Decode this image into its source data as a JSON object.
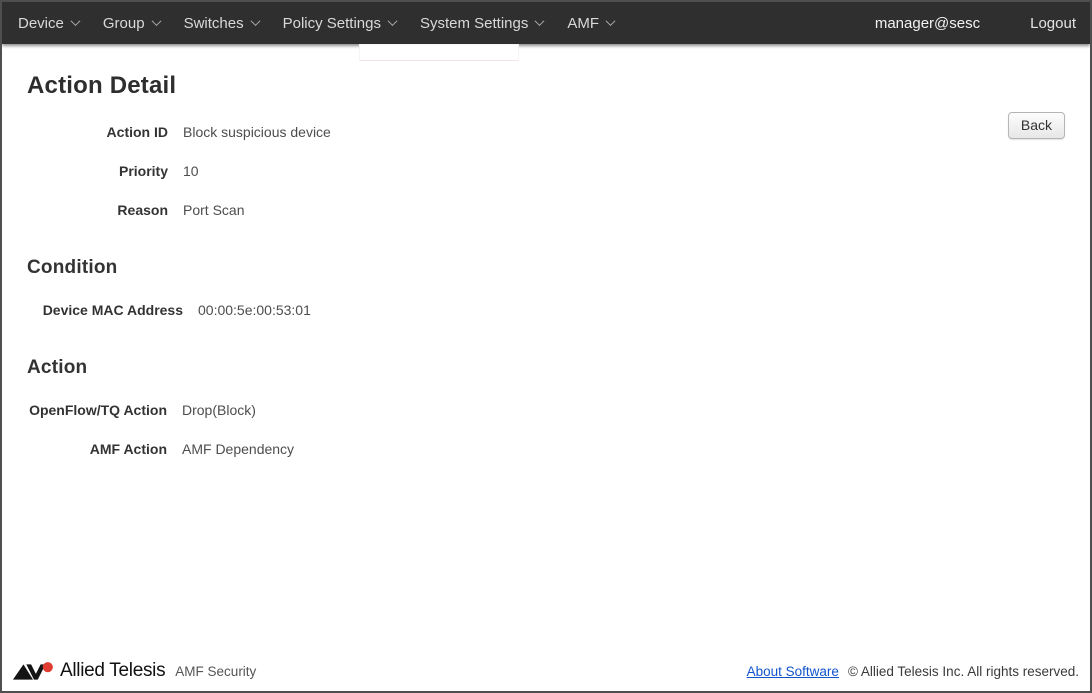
{
  "navbar": {
    "items": [
      {
        "label": "Device"
      },
      {
        "label": "Group"
      },
      {
        "label": "Switches"
      },
      {
        "label": "Policy Settings"
      },
      {
        "label": "System Settings"
      },
      {
        "label": "AMF"
      }
    ],
    "user": "manager@sesc",
    "logout_label": "Logout",
    "bg_color": "#2f2f2f"
  },
  "page": {
    "title": "Action Detail",
    "back_button_label": "Back",
    "detail_fields": [
      {
        "label": "Action ID",
        "value": "Block suspicious device"
      },
      {
        "label": "Priority",
        "value": "10"
      },
      {
        "label": "Reason",
        "value": "Port Scan"
      }
    ],
    "condition_section": {
      "heading": "Condition",
      "fields": [
        {
          "label": "Device MAC Address",
          "value": "00:00:5e:00:53:01"
        }
      ]
    },
    "action_section": {
      "heading": "Action",
      "fields": [
        {
          "label": "OpenFlow/TQ Action",
          "value": "Drop(Block)"
        },
        {
          "label": "AMF Action",
          "value": "AMF Dependency"
        }
      ]
    }
  },
  "footer": {
    "brand": "Allied Telesis",
    "product": "AMF Security",
    "about_link_label": "About Software",
    "copyright": "© Allied Telesis Inc. All rights reserved.",
    "logo_red": "#e03c31"
  }
}
